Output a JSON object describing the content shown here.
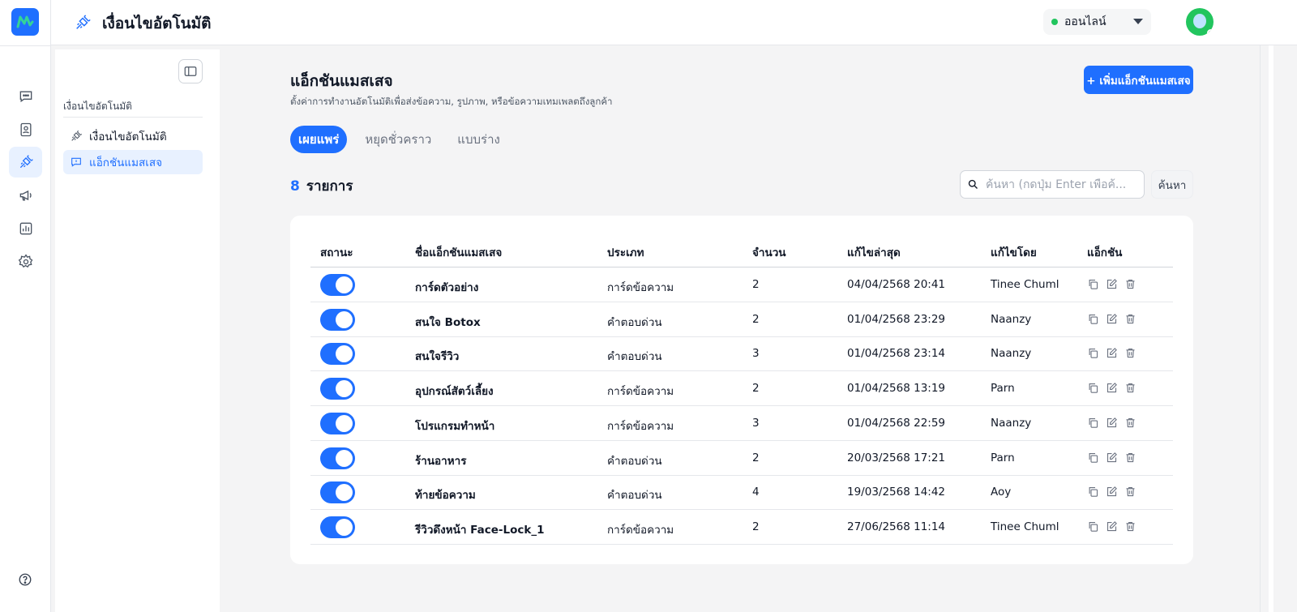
{
  "topbar": {
    "title": "เงื่อนไขอัตโนมัติ",
    "status_label": "ออนไลน์"
  },
  "panel": {
    "section_label": "เงื่อนไขอัตโนมัติ",
    "items": [
      {
        "label": "เงื่อนไขอัตโนมัติ"
      },
      {
        "label": "แอ็กชันแมสเสจ"
      }
    ]
  },
  "main": {
    "title": "แอ็กชันแมสเสจ",
    "subtitle": "ตั้งค่าการทำงานอัตโนมัติเพื่อส่งข้อความ, รูปภาพ, หรือข้อความเทมเพลตถึงลูกค้า",
    "add_button": "+ เพิ่มแอ็กชันแมสเสจ",
    "tabs": [
      "เผยแพร่",
      "หยุดชั่วคราว",
      "แบบร่าง"
    ],
    "count": "8",
    "count_label": "รายการ",
    "search_placeholder": "ค้นหา (กดปุ่ม Enter เพื่อค้...",
    "search_button": "ค้นหา"
  },
  "table": {
    "headers": [
      "สถานะ",
      "ชื่อแอ็กชันแมสเสจ",
      "ประเภท",
      "จำนวน",
      "แก้ไขล่าสุด",
      "แก้ไขโดย",
      "แอ็กชัน"
    ],
    "rows": [
      {
        "name": "การ์ดตัวอย่าง",
        "type": "การ์ดข้อความ",
        "qty": "2",
        "date": "04/04/2568 20:41",
        "by": "Tinee Chuml"
      },
      {
        "name": "สนใจ Botox",
        "type": "คำตอบด่วน",
        "qty": "2",
        "date": "01/04/2568 23:29",
        "by": "Naanzy"
      },
      {
        "name": "สนใจรีวิว",
        "type": "คำตอบด่วน",
        "qty": "3",
        "date": "01/04/2568 23:14",
        "by": "Naanzy"
      },
      {
        "name": "อุปกรณ์สัตว์เลี้ยง",
        "type": "การ์ดข้อความ",
        "qty": "2",
        "date": "01/04/2568 13:19",
        "by": "Parn"
      },
      {
        "name": "โปรแกรมทำหน้า",
        "type": "การ์ดข้อความ",
        "qty": "3",
        "date": "01/04/2568 22:59",
        "by": "Naanzy"
      },
      {
        "name": "ร้านอาหาร",
        "type": "คำตอบด่วน",
        "qty": "2",
        "date": "20/03/2568 17:21",
        "by": "Parn"
      },
      {
        "name": "ท้ายข้อความ",
        "type": "คำตอบด่วน",
        "qty": "4",
        "date": "19/03/2568 14:42",
        "by": "Aoy"
      },
      {
        "name": "รีวิวดึงหน้า Face-Lock_1",
        "type": "การ์ดข้อความ",
        "qty": "2",
        "date": "27/06/2568 11:14",
        "by": "Tinee Chuml"
      }
    ]
  },
  "colors": {
    "accent": "#1f6fff",
    "online": "#22c55e"
  }
}
